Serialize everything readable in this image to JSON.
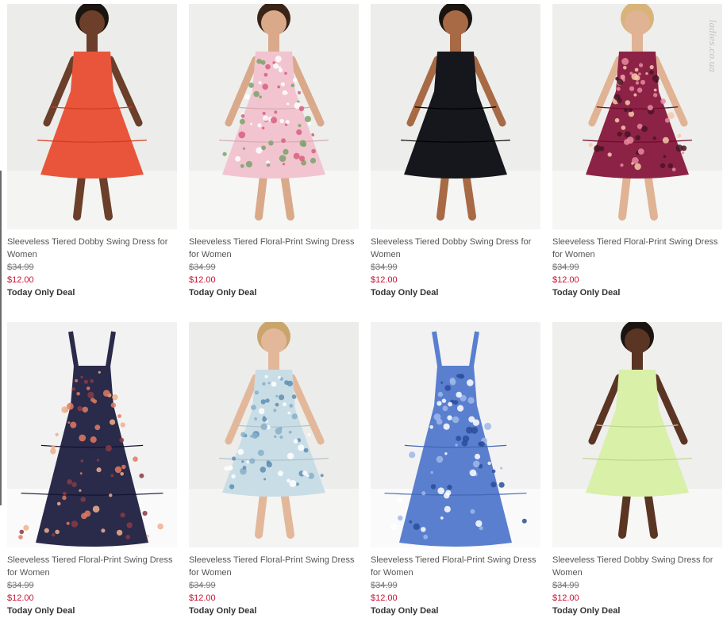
{
  "products": [
    {
      "name": "Sleeveless Tiered Dobby Swing Dress for Women",
      "original_price": "$34.99",
      "sale_price": "$12.00",
      "deal": "Today Only Deal",
      "dress_color": "#e8553a",
      "pattern": "solid",
      "bg": "#ececea"
    },
    {
      "name": "Sleeveless Tiered Floral-Print Swing Dress for Women",
      "original_price": "$34.99",
      "sale_price": "$12.00",
      "deal": "Today Only Deal",
      "dress_color": "#f1c4cf",
      "pattern": "floral-pink",
      "bg": "#eeeeec"
    },
    {
      "name": "Sleeveless Tiered Dobby Swing Dress for Women",
      "original_price": "$34.99",
      "sale_price": "$12.00",
      "deal": "Today Only Deal",
      "dress_color": "#15171c",
      "pattern": "solid",
      "bg": "#ededeb"
    },
    {
      "name": "Sleeveless Tiered Floral-Print Swing Dress for Women",
      "original_price": "$34.99",
      "sale_price": "$12.00",
      "deal": "Today Only Deal",
      "dress_color": "#8c2346",
      "pattern": "floral-burgundy",
      "bg": "#eeeeec"
    },
    {
      "name": "Sleeveless Tiered Floral-Print Swing Dress for Women",
      "original_price": "$34.99",
      "sale_price": "$12.00",
      "deal": "Today Only Deal",
      "dress_color": "#2a2a4a",
      "pattern": "paisley-navy",
      "bg": "#f2f2f2"
    },
    {
      "name": "Sleeveless Tiered Floral-Print Swing Dress for Women",
      "original_price": "$34.99",
      "sale_price": "$12.00",
      "deal": "Today Only Deal",
      "dress_color": "#c9dde6",
      "pattern": "floral-light",
      "bg": "#ececea"
    },
    {
      "name": "Sleeveless Tiered Floral-Print Swing Dress for Women",
      "original_price": "$34.99",
      "sale_price": "$12.00",
      "deal": "Today Only Deal",
      "dress_color": "#5b7fcf",
      "pattern": "floral-blue",
      "bg": "#f2f2f2"
    },
    {
      "name": "Sleeveless Tiered Dobby Swing Dress for Women",
      "original_price": "$34.99",
      "sale_price": "$12.00",
      "deal": "Today Only Deal",
      "dress_color": "#d8f0a8",
      "pattern": "solid",
      "bg": "#efefed"
    }
  ]
}
